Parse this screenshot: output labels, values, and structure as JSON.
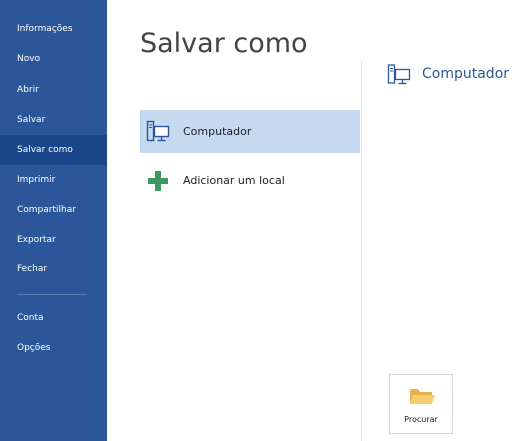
{
  "sidebar": {
    "items": [
      {
        "label": "Informações"
      },
      {
        "label": "Novo"
      },
      {
        "label": "Abrir"
      },
      {
        "label": "Salvar"
      },
      {
        "label": "Salvar como",
        "active": true
      },
      {
        "label": "Imprimir"
      },
      {
        "label": "Compartilhar"
      },
      {
        "label": "Exportar"
      },
      {
        "label": "Fechar"
      },
      {
        "label": "Conta"
      },
      {
        "label": "Opções"
      }
    ]
  },
  "main": {
    "title": "Salvar como",
    "places": [
      {
        "label": "Computador",
        "icon": "computer-icon",
        "selected": true
      },
      {
        "label": "Adicionar um local",
        "icon": "plus-icon"
      }
    ],
    "right_heading": {
      "label": "Computador",
      "icon": "computer-icon"
    },
    "browse_label": "Procurar"
  },
  "colors": {
    "sidebar_bg": "#2b579a",
    "sidebar_active": "#19478a",
    "selected_place": "#c5d9f1",
    "accent": "#2b579a",
    "plus_green": "#3c9a5f"
  }
}
